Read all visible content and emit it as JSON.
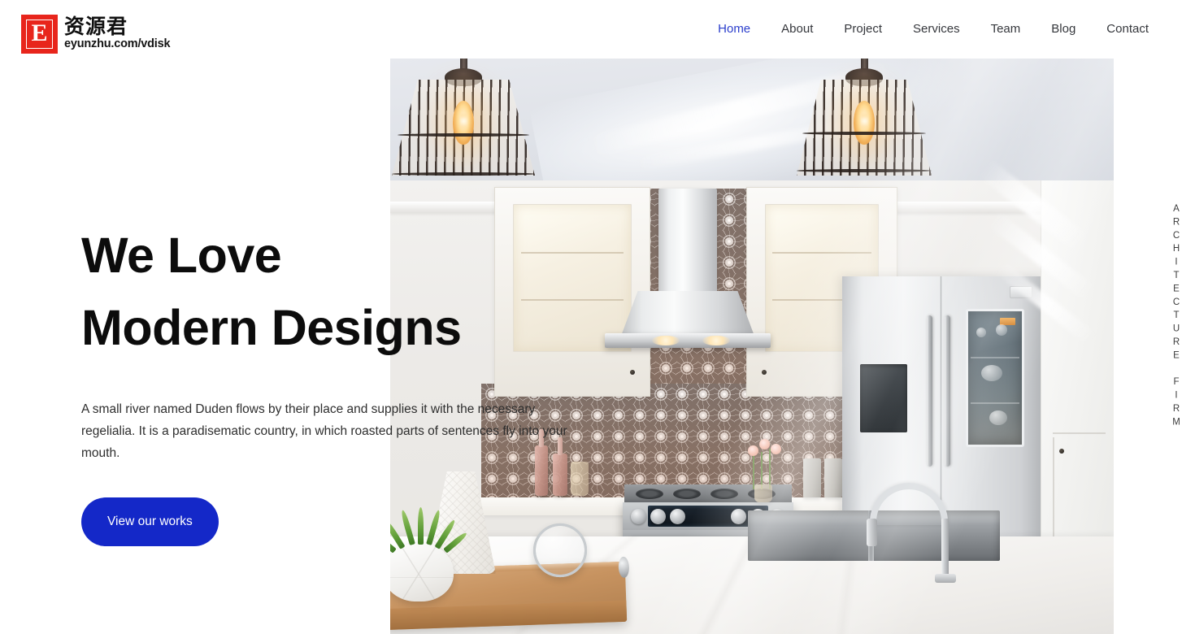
{
  "brand": {
    "mark_letter": "E",
    "name_cn": "资源君",
    "url": "eyunzhu.com/vdisk",
    "mark_color": "#e8251c"
  },
  "nav": {
    "items": [
      {
        "label": "Home",
        "active": true
      },
      {
        "label": "About",
        "active": false
      },
      {
        "label": "Project",
        "active": false
      },
      {
        "label": "Services",
        "active": false
      },
      {
        "label": "Team",
        "active": false
      },
      {
        "label": "Blog",
        "active": false
      },
      {
        "label": "Contact",
        "active": false
      }
    ],
    "active_color": "#2b3ecc",
    "inactive_color": "#35373c"
  },
  "hero": {
    "title_line1": "We Love",
    "title_line2": "Modern Designs",
    "paragraph": "A small river named Duden flows by their place and supplies it with the necessary regelialia. It is a paradisematic country, in which roasted parts of sentences fly into your mouth.",
    "cta_label": "View our works",
    "cta_color": "#1428c8",
    "cta_text_color": "#ffffff",
    "title_color": "#0c0c0c"
  },
  "side_label": {
    "text": "ARCHITECTURE FIRM",
    "color": "#3c3c3c"
  },
  "hero_image": {
    "alt": "Modern white kitchen interior with wire cage pendant lamps, patterned mosaic backsplash, stainless steel range and refrigerator, marble island with decorative wooden tray"
  }
}
